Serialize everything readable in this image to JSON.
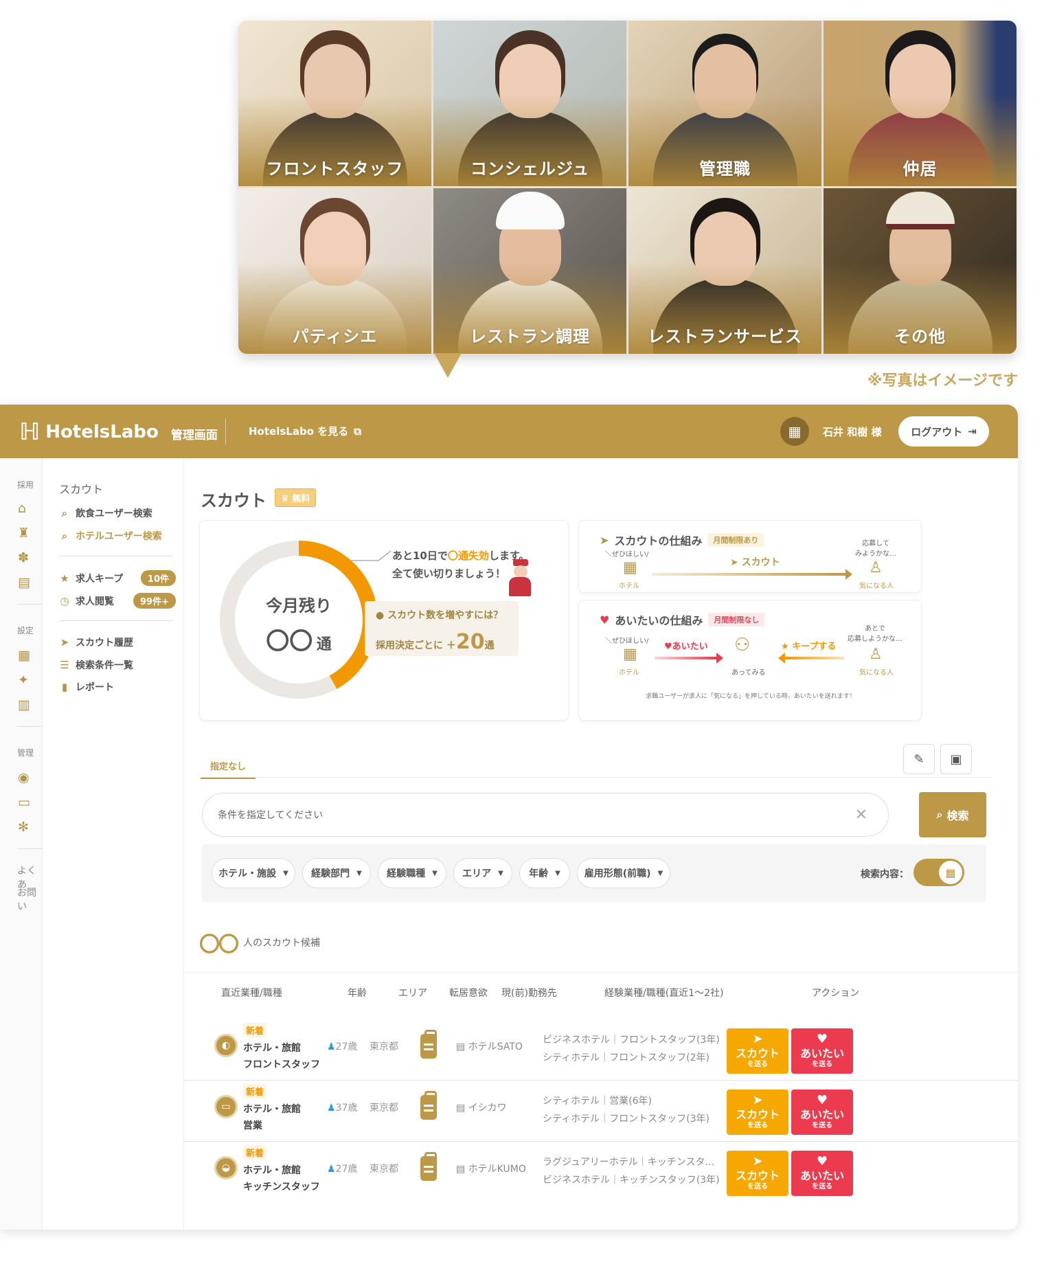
{
  "tiles": [
    {
      "label": "フロントスタッフ"
    },
    {
      "label": "コンシェルジュ"
    },
    {
      "label": "管理職"
    },
    {
      "label": "仲居"
    },
    {
      "label": "パティシエ"
    },
    {
      "label": "レストラン調理"
    },
    {
      "label": "レストランサービス"
    },
    {
      "label": "その他"
    }
  ],
  "note": "※写真はイメージです",
  "header": {
    "logo": "HotelsLabo",
    "subtitle": "管理画面",
    "view_link": "HotelsLabo を見る",
    "user": "石井 和樹 様",
    "logout": "ログアウト"
  },
  "rail": {
    "sections": [
      "採用",
      "設定",
      "管理"
    ],
    "items": [
      "よくあ",
      "お問い"
    ]
  },
  "sidebar": {
    "title": "スカウト",
    "items": [
      {
        "label": "飲食ユーザー検索",
        "icon": "search-icon"
      },
      {
        "label": "ホテルユーザー検索",
        "icon": "search-icon"
      },
      {
        "label": "求人キープ",
        "icon": "star-icon",
        "badge": "10件"
      },
      {
        "label": "求人閲覧",
        "icon": "clock-icon",
        "badge": "99件+"
      },
      {
        "label": "スカウト履歴",
        "icon": "paper-plane-icon"
      },
      {
        "label": "検索条件一覧",
        "icon": "list-icon"
      },
      {
        "label": "レポート",
        "icon": "bar-chart-icon"
      }
    ]
  },
  "page": {
    "title": "スカウト",
    "free_badge": "無料"
  },
  "remaining": {
    "label": "今月残り",
    "count": "〇〇",
    "unit": "通",
    "used_fraction": 0.42,
    "callout_pre": "あと10日で",
    "callout_hl": "〇通失効",
    "callout_post": "します。",
    "callout2": "全て使い切りましょう！",
    "tip_q": "スカウト数を増やすには？",
    "tip_pre": "採用決定ごとに ＋",
    "tip_num": "20",
    "tip_unit": "通"
  },
  "scout_mech": {
    "title": "スカウトの仕組み",
    "tag": "月間制限あり",
    "left_top": "＼ぜひほしい/",
    "left": "ホテル",
    "arrow": "スカウト",
    "right_top": "応募して\nみようかな…",
    "right": "気になる人"
  },
  "aitai_mech": {
    "title": "あいたいの仕組み",
    "tag": "月間制限なし",
    "left_top": "＼ぜひほしい/",
    "left": "ホテル",
    "arrow1": "あいたい",
    "middle": "あってみる",
    "arrow2": "キープする",
    "right_top": "あとで\n応募しようかな…",
    "right": "気になる人",
    "foot": "求職ユーザーが求人に「気になる」を押している時、あいたいを送れます！"
  },
  "search": {
    "tab": "指定なし",
    "placeholder": "条件を指定してください",
    "button": "検索",
    "filters": [
      "ホテル・施設",
      "経験部門",
      "経験職種",
      "エリア",
      "年齢",
      "雇用形態(前職)"
    ],
    "content_label": "検索内容："
  },
  "results": {
    "count": "〇〇",
    "count_label": "人のスカウト候補",
    "columns": [
      "直近業種/職種",
      "年齢",
      "エリア",
      "転居意欲",
      "現(前)勤務先",
      "経験業種/職種(直近1〜2社)",
      "アクション"
    ],
    "rows": [
      {
        "new": "新着",
        "industry": "ホテル・旅館",
        "job": "フロントスタッフ",
        "age": "27歳",
        "area": "東京都",
        "workplace": "ホテルSATO",
        "exp1": "ビジネスホテル｜フロントスタッフ(3年)",
        "exp2": "シティホテル｜フロントスタッフ(2年)"
      },
      {
        "new": "新着",
        "industry": "ホテル・旅館",
        "job": "営業",
        "age": "37歳",
        "area": "東京都",
        "workplace": "イシカワ",
        "exp1": "シティホテル｜営業(6年)",
        "exp2": "シティホテル｜フロントスタッフ(3年)"
      },
      {
        "new": "新着",
        "industry": "ホテル・旅館",
        "job": "キッチンスタッフ",
        "age": "27歳",
        "area": "東京都",
        "workplace": "ホテルKUMO",
        "exp1": "ラグジュアリーホテル｜キッチンスタ…",
        "exp2": "ビジネスホテル｜キッチンスタッフ(3年)"
      }
    ],
    "scout_btn": "スカウト",
    "aitai_btn": "あいたい",
    "send": "を送る"
  },
  "colors": {
    "accent": "#bd9847",
    "orange": "#f39800",
    "red": "#ec3a4e"
  }
}
